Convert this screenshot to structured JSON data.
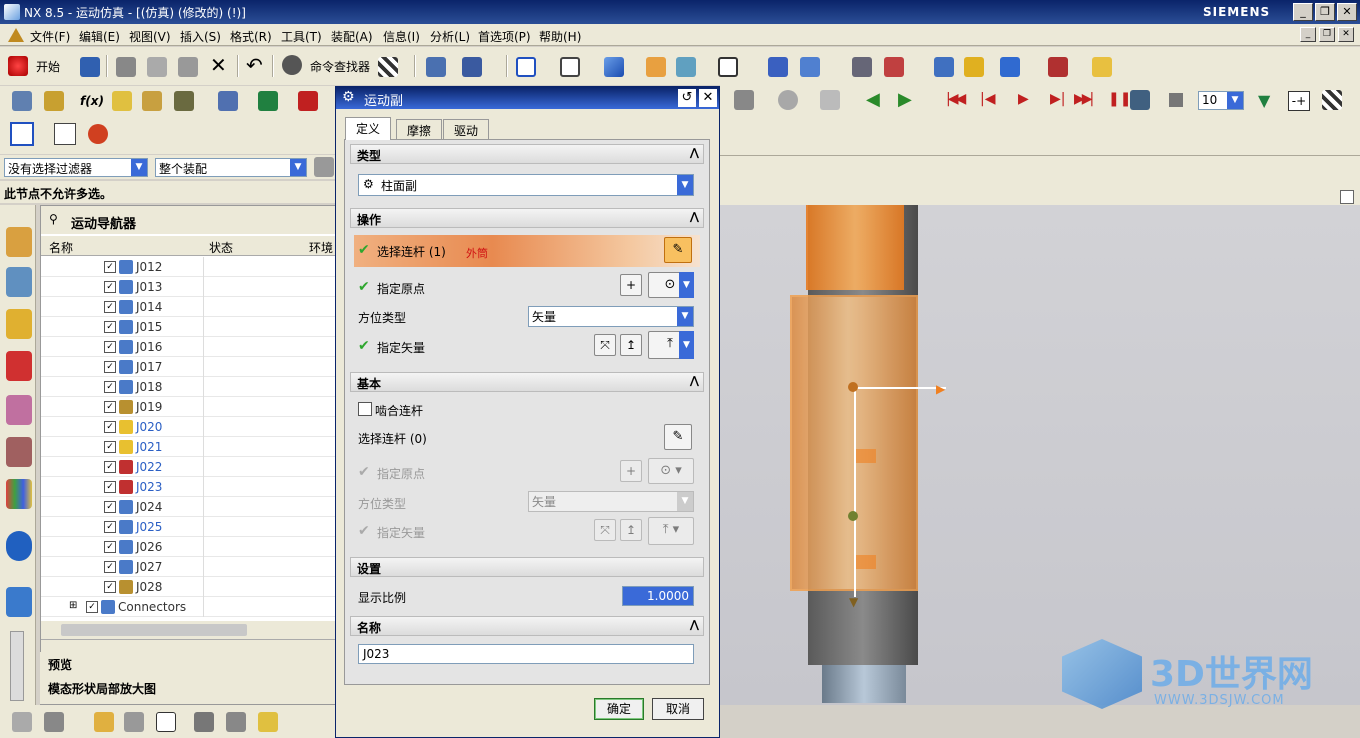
{
  "window": {
    "title": "NX 8.5 - 运动仿真 - [(仿真)                  (修改的)      (!)]",
    "brand": "SIEMENS"
  },
  "menu": [
    "文件(F)",
    "编辑(E)",
    "视图(V)",
    "插入(S)",
    "格式(R)",
    "工具(T)",
    "装配(A)",
    "信息(I)",
    "分析(L)",
    "首选项(P)",
    "帮助(H)"
  ],
  "toolbar": {
    "start_label": "开始",
    "command_finder": "命令查找器",
    "anim_step": "10"
  },
  "filters": {
    "selection_filter": "没有选择过滤器",
    "scope": "整个装配"
  },
  "status": "此节点不允许多选。",
  "navigator": {
    "title": "运动导航器",
    "columns": [
      "名称",
      "状态",
      "环境"
    ],
    "rows": [
      {
        "label": "J012",
        "color": "#333",
        "icon": "cylindrical-joint-icon"
      },
      {
        "label": "J013",
        "color": "#333",
        "icon": "cylindrical-joint-icon"
      },
      {
        "label": "J014",
        "color": "#333",
        "icon": "cylindrical-joint-icon"
      },
      {
        "label": "J015",
        "color": "#333",
        "icon": "cylindrical-joint-icon"
      },
      {
        "label": "J016",
        "color": "#333",
        "icon": "cylindrical-joint-icon"
      },
      {
        "label": "J017",
        "color": "#333",
        "icon": "cylindrical-joint-icon"
      },
      {
        "label": "J018",
        "color": "#333",
        "icon": "cylindrical-joint-icon"
      },
      {
        "label": "J019",
        "color": "#333",
        "icon": "screw-joint-icon"
      },
      {
        "label": "J020",
        "color": "#2b5fc4",
        "icon": "planar-joint-icon"
      },
      {
        "label": "J021",
        "color": "#2b5fc4",
        "icon": "planar-joint-icon"
      },
      {
        "label": "J022",
        "color": "#2b5fc4",
        "icon": "universal-joint-icon"
      },
      {
        "label": "J023",
        "color": "#2b5fc4",
        "icon": "universal-joint-icon"
      },
      {
        "label": "J024",
        "color": "#333",
        "icon": "cylindrical-joint-icon"
      },
      {
        "label": "J025",
        "color": "#2b5fc4",
        "icon": "fixed-joint-icon"
      },
      {
        "label": "J026",
        "color": "#333",
        "icon": "cylindrical-joint-icon"
      },
      {
        "label": "J027",
        "color": "#333",
        "icon": "cylindrical-joint-icon"
      },
      {
        "label": "J028",
        "color": "#333",
        "icon": "screw-joint-icon"
      },
      {
        "label": "Connectors",
        "color": "#333",
        "icon": "connectors-icon"
      }
    ]
  },
  "panels": {
    "preview": "预览",
    "enlarged": "模态形状局部放大图"
  },
  "dialog": {
    "title": "运动副",
    "tabs": [
      "定义",
      "摩擦",
      "驱动"
    ],
    "type_header": "类型",
    "type_value": "柱面副",
    "op_header": "操作",
    "select_link": "选择连杆 (1)",
    "link_name": "外筒",
    "origin": "指定原点",
    "orient_type": "方位类型",
    "orient_value": "矢量",
    "vector": "指定矢量",
    "base_header": "基本",
    "snap_link": "啮合连杆",
    "select_link0": "选择连杆 (0)",
    "base_origin": "指定原点",
    "base_orient": "方位类型",
    "base_orient_value": "矢量",
    "base_vector": "指定矢量",
    "settings_header": "设置",
    "scale_label": "显示比例",
    "scale_value": "1.0000",
    "name_header": "名称",
    "name_value": "J023",
    "ok": "确定",
    "cancel": "取消"
  },
  "watermark": {
    "brand": "3D世界网",
    "url": "WWW.3DSJW.COM"
  },
  "colors": {
    "accent": "#f39c3a",
    "check": "#2ea62e",
    "titlebar": "#0a246a"
  }
}
